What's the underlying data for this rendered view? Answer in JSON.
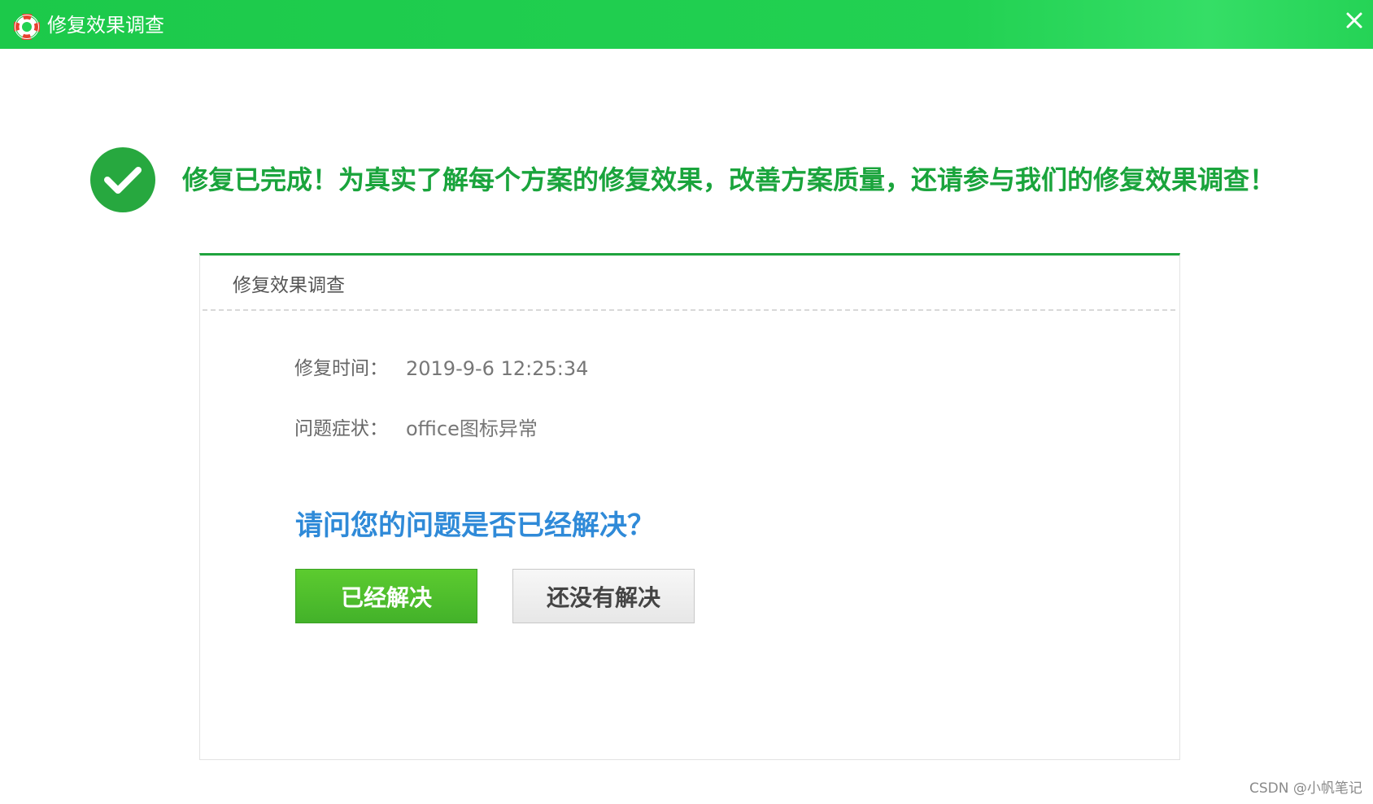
{
  "window": {
    "title": "修复效果调查",
    "icon": "lifebuoy-icon",
    "close_icon": "close-icon"
  },
  "headline": {
    "icon": "check-circle-icon",
    "text": "修复已完成！为真实了解每个方案的修复效果，改善方案质量，还请参与我们的修复效果调查！"
  },
  "survey": {
    "panel_title": "修复效果调查",
    "repair_time_label": "修复时间：",
    "repair_time_value": "2019-9-6 12:25:34",
    "symptom_label": "问题症状：",
    "symptom_value": "office图标异常",
    "question": "请问您的问题是否已经解决？",
    "solved_button": "已经解决",
    "unsolved_button": "还没有解决"
  },
  "watermark": "CSDN @小帆笔记",
  "colors": {
    "titlebar": "#22d152",
    "headline": "#1aa43c",
    "panel_border_top": "#1fa33d",
    "question": "#2f8ad8",
    "solved_button": "#4cbd2c"
  }
}
